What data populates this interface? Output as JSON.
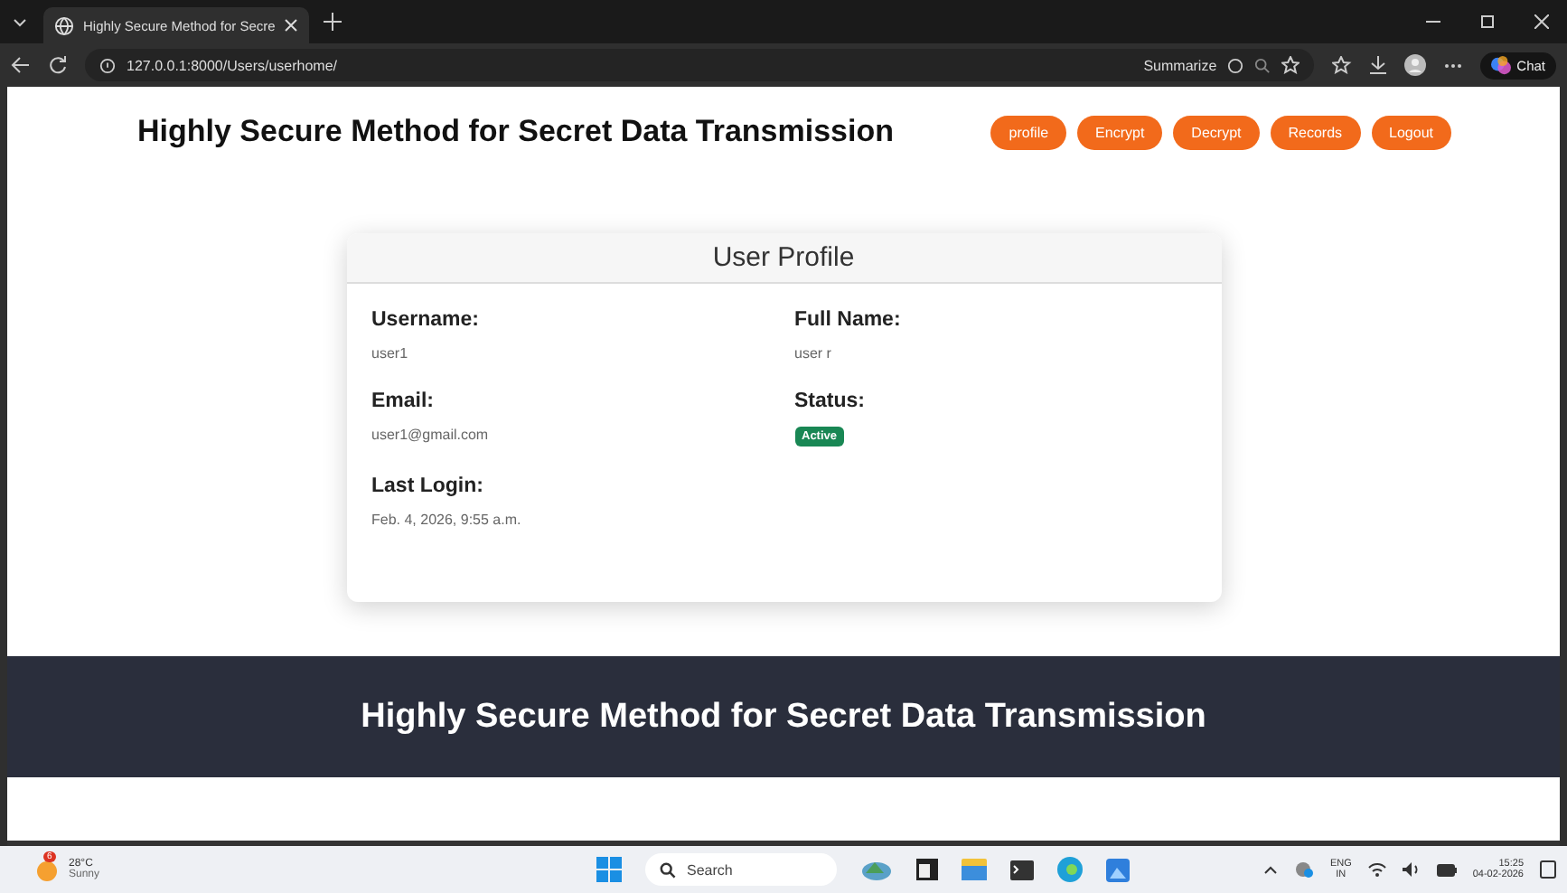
{
  "browser": {
    "tab_title": "Highly Secure Method for Secre",
    "address": "127.0.0.1:8000/Users/userhome/",
    "summarize": "Summarize",
    "chat": "Chat"
  },
  "header": {
    "title": "Highly Secure Method for Secret Data Transmission",
    "nav": [
      {
        "label": "profile"
      },
      {
        "label": "Encrypt"
      },
      {
        "label": "Decrypt"
      },
      {
        "label": "Records"
      },
      {
        "label": "Logout"
      }
    ]
  },
  "profile_card": {
    "title": "User Profile",
    "fields": [
      {
        "label": "Username:",
        "value": "user1",
        "kind": "text"
      },
      {
        "label": "Full Name:",
        "value": "user r",
        "kind": "text"
      },
      {
        "label": "Email:",
        "value": "user1@gmail.com",
        "kind": "text"
      },
      {
        "label": "Status:",
        "value": "Active",
        "kind": "badge"
      },
      {
        "label": "Last Login:",
        "value": "Feb. 4, 2026, 9:55 a.m.",
        "kind": "text"
      }
    ]
  },
  "footer": {
    "title": "Highly Secure Method for Secret Data Transmission"
  },
  "taskbar": {
    "temperature": "28°C",
    "weather": "Sunny",
    "weather_badge": "6",
    "search": "Search",
    "language": "ENG",
    "region": "IN",
    "time": "15:25",
    "date": "04-02-2026"
  }
}
